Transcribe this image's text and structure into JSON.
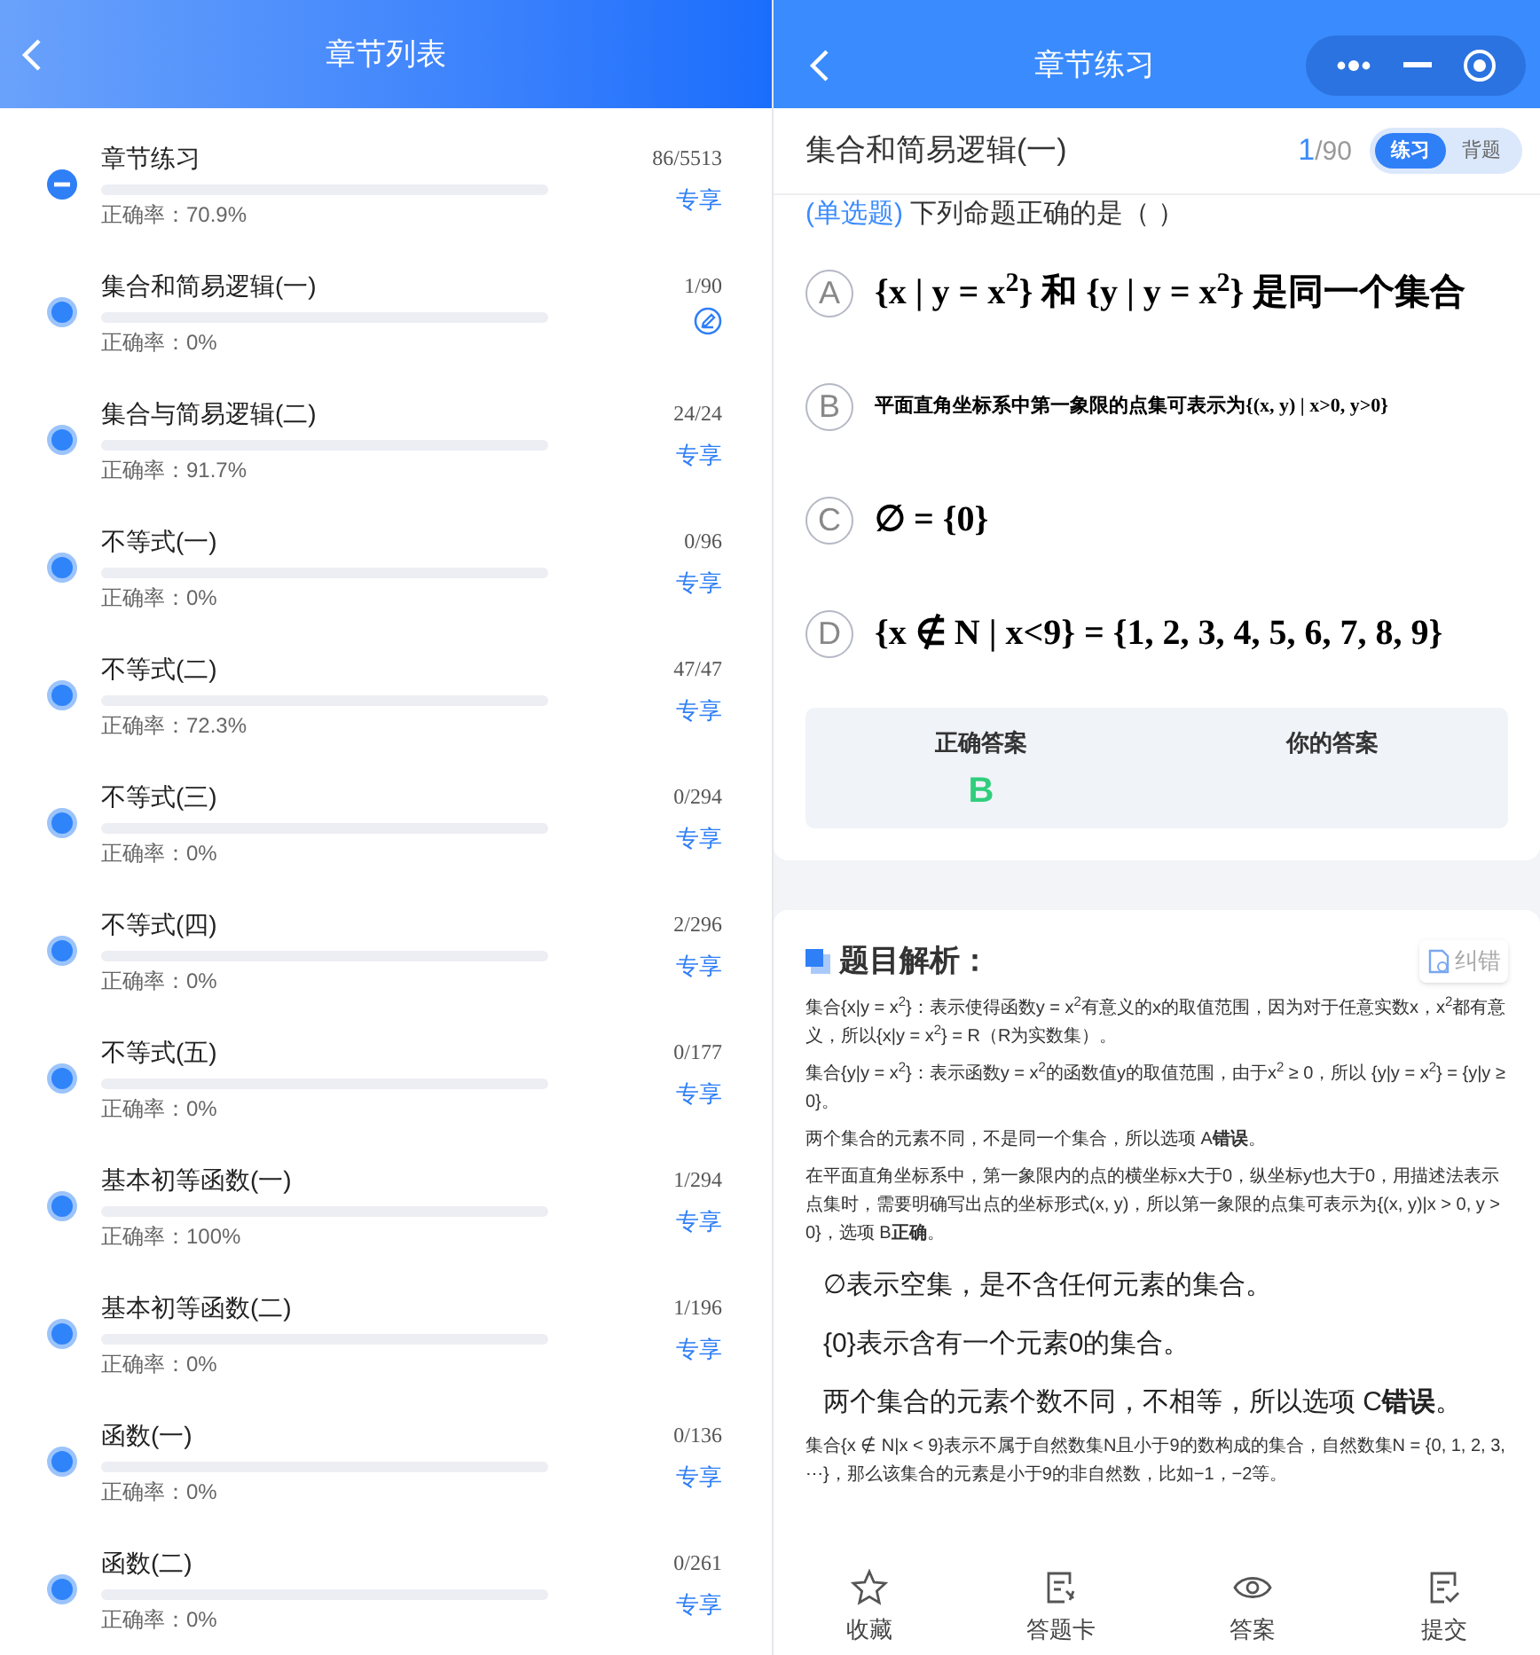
{
  "list_screen": {
    "title": "章节列表",
    "chapters": [
      {
        "kind": "group",
        "name": "章节练习",
        "count": "86/5513",
        "accuracy": "正确率：70.9%",
        "action": {
          "kind": "label",
          "text": "专享"
        }
      },
      {
        "kind": "chapter",
        "name": "集合和简易逻辑(一)",
        "count": "1/90",
        "accuracy": "正确率：0%",
        "action": {
          "kind": "edit"
        }
      },
      {
        "kind": "chapter",
        "name": "集合与简易逻辑(二)",
        "count": "24/24",
        "accuracy": "正确率：91.7%",
        "action": {
          "kind": "label",
          "text": "专享"
        }
      },
      {
        "kind": "chapter",
        "name": "不等式(一)",
        "count": "0/96",
        "accuracy": "正确率：0%",
        "action": {
          "kind": "label",
          "text": "专享"
        }
      },
      {
        "kind": "chapter",
        "name": "不等式(二)",
        "count": "47/47",
        "accuracy": "正确率：72.3%",
        "action": {
          "kind": "label",
          "text": "专享"
        }
      },
      {
        "kind": "chapter",
        "name": "不等式(三)",
        "count": "0/294",
        "accuracy": "正确率：0%",
        "action": {
          "kind": "label",
          "text": "专享"
        }
      },
      {
        "kind": "chapter",
        "name": "不等式(四)",
        "count": "2/296",
        "accuracy": "正确率：0%",
        "action": {
          "kind": "label",
          "text": "专享"
        }
      },
      {
        "kind": "chapter",
        "name": "不等式(五)",
        "count": "0/177",
        "accuracy": "正确率：0%",
        "action": {
          "kind": "label",
          "text": "专享"
        }
      },
      {
        "kind": "chapter",
        "name": "基本初等函数(一)",
        "count": "1/294",
        "accuracy": "正确率：100%",
        "action": {
          "kind": "label",
          "text": "专享"
        }
      },
      {
        "kind": "chapter",
        "name": "基本初等函数(二)",
        "count": "1/196",
        "accuracy": "正确率：0%",
        "action": {
          "kind": "label",
          "text": "专享"
        }
      },
      {
        "kind": "chapter",
        "name": "函数(一)",
        "count": "0/136",
        "accuracy": "正确率：0%",
        "action": {
          "kind": "label",
          "text": "专享"
        }
      },
      {
        "kind": "chapter",
        "name": "函数(二)",
        "count": "0/261",
        "accuracy": "正确率：0%",
        "action": {
          "kind": "label",
          "text": "专享"
        }
      }
    ]
  },
  "practice_screen": {
    "title": "章节练习",
    "chapter_title": "集合和简易逻辑(一)",
    "index": "1",
    "total": "/90",
    "modes": [
      {
        "label": "练习",
        "selected": true
      },
      {
        "label": "背题",
        "selected": false
      }
    ],
    "question_type": "(单选题)",
    "question": "下列命题正确的是（ ）",
    "options": [
      {
        "letter": "A",
        "kind": "large",
        "text": "{x | y = x$^{2}$} 和 {y | y = x$^{2}$} 是同一个集合"
      },
      {
        "letter": "B",
        "kind": "small",
        "text": "平面直角坐标系中第一象限的点集可表示为{(x, y) | x>0, y>0}"
      },
      {
        "letter": "C",
        "kind": "large",
        "text": "∅ = {0}"
      },
      {
        "letter": "D",
        "kind": "large",
        "text": "{x ∉ N | x<9} = {1, 2, 3, 4, 5, 6, 7, 8, 9}"
      }
    ],
    "answers": [
      {
        "label": "正确答案",
        "value": "B"
      },
      {
        "label": "你的答案"
      }
    ],
    "analysis_title": "题目解析：",
    "report_button": "纠错",
    "analysis": [
      {
        "kind": "small",
        "text": "集合{x|y = x$^{2}$}：表示使得函数y = x$^{2}$有意义的x的取值范围，因为对于任意实数x，x$^{2}$都有意义，所以{x|y = x$^{2}$} = R（R为实数集）。"
      },
      {
        "kind": "small",
        "text": "集合{y|y = x$^{2}$}：表示函数y = x$^{2}$的函数值y的取值范围，由于x$^{2}$ ≥ 0，所以 {y|y = x$^{2}$} = {y|y ≥ 0}。"
      },
      {
        "kind": "small",
        "text": "两个集合的元素不同，不是同一个集合，所以选项 A**错误**。"
      },
      {
        "kind": "small",
        "text": "在平面直角坐标系中，第一象限内的点的横坐标x大于0，纵坐标y也大于0，用描述法表示点集时，需要明确写出点的坐标形式(x, y)，所以第一象限的点集可表示为{(x, y)|x > 0, y > 0}，选项 B**正确**。"
      },
      {
        "kind": "large",
        "text": "∅表示空集，是不含任何元素的集合。"
      },
      {
        "kind": "large",
        "text": "{0}表示含有一个元素0的集合。"
      },
      {
        "kind": "large",
        "text": "两个集合的元素个数不同，不相等，所以选项 C**错误**。"
      },
      {
        "kind": "small",
        "text": "集合{x ∉ N|x < 9}表示不属于自然数集N且小于9的数构成的集合，自然数集N = {0, 1, 2, 3, ⋯}，那么该集合的元素是小于9的非自然数，比如−1，−2等。"
      }
    ],
    "bottom_tabs": [
      {
        "kind": "star",
        "label": "收藏"
      },
      {
        "kind": "card",
        "label": "答题卡"
      },
      {
        "kind": "eye",
        "label": "答案"
      },
      {
        "kind": "submit",
        "label": "提交"
      }
    ]
  }
}
